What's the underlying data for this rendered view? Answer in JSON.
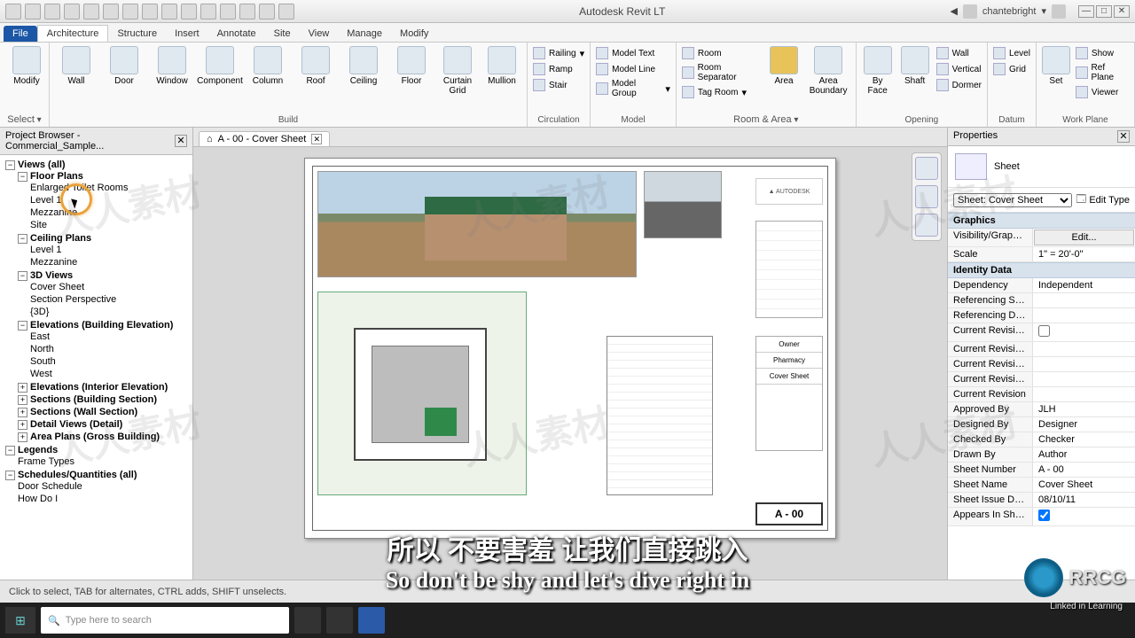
{
  "app_title": "Autodesk Revit LT",
  "user": "chantebright",
  "menu": {
    "file": "File",
    "arch": "Architecture",
    "struct": "Structure",
    "insert": "Insert",
    "annotate": "Annotate",
    "site": "Site",
    "view": "View",
    "manage": "Manage",
    "modify": "Modify"
  },
  "ribbon": {
    "select": {
      "modify": "Modify",
      "select": "Select"
    },
    "build": {
      "wall": "Wall",
      "door": "Door",
      "window": "Window",
      "component": "Component",
      "column": "Column",
      "roof": "Roof",
      "ceiling": "Ceiling",
      "floor": "Floor",
      "curtain": "Curtain\nGrid",
      "mullion": "Mullion",
      "name": "Build"
    },
    "circ": {
      "railing": "Railing",
      "ramp": "Ramp",
      "stair": "Stair",
      "name": "Circulation"
    },
    "model": {
      "text": "Model Text",
      "line": "Model Line",
      "group": "Model Group",
      "name": "Model"
    },
    "room": {
      "room": "Room",
      "sep": "Room Separator",
      "tag": "Tag Room",
      "area": "Area",
      "areab": "Area\nBoundary",
      "name": "Room & Area"
    },
    "open": {
      "face": "By\nFace",
      "shaft": "Shaft",
      "wall": "Wall",
      "vert": "Vertical",
      "dormer": "Dormer",
      "name": "Opening"
    },
    "datum": {
      "level": "Level",
      "grid": "Grid",
      "name": "Datum"
    },
    "wp": {
      "set": "Set",
      "show": "Show",
      "ref": "Ref Plane",
      "viewer": "Viewer",
      "name": "Work Plane"
    }
  },
  "pb_title": "Project Browser - Commercial_Sample...",
  "tree": {
    "root": "Views (all)",
    "floorplans": "Floor Plans",
    "fp": [
      "Enlarged Toilet Rooms",
      "Level 1",
      "Mezzanine",
      "Site"
    ],
    "ceiling": "Ceiling Plans",
    "cp": [
      "Level 1",
      "Mezzanine"
    ],
    "views3d": "3D Views",
    "v3": [
      "Cover Sheet",
      "Section Perspective",
      "{3D}"
    ],
    "elevB": "Elevations (Building Elevation)",
    "eb": [
      "East",
      "North",
      "South",
      "West"
    ],
    "elevI": "Elevations (Interior Elevation)",
    "secB": "Sections (Building Section)",
    "secW": "Sections (Wall Section)",
    "detail": "Detail Views (Detail)",
    "area": "Area Plans (Gross Building)",
    "legends": "Legends",
    "lg": [
      "Frame Types"
    ],
    "sched": "Schedules/Quantities (all)",
    "sc": [
      "Door Schedule",
      "How Do I"
    ]
  },
  "doc_tab": "A - 00 - Cover Sheet",
  "logo": "▲ AUTODESK",
  "titleblock": {
    "owner": "Owner",
    "project": "Pharmacy",
    "sheet": "Cover Sheet",
    "num": "A - 00"
  },
  "props": {
    "title": "Properties",
    "type": "Sheet",
    "selector": "Sheet: Cover Sheet",
    "edit_type": "Edit Type",
    "sec_graphics": "Graphics",
    "vis": "Visibility/Graphi...",
    "vis_v": "Edit...",
    "scale": "Scale",
    "scale_v": "1\" = 20'-0\"",
    "sec_identity": "Identity Data",
    "dep": "Dependency",
    "dep_v": "Independent",
    "refsh": "Referencing Sh...",
    "refsh_v": "",
    "refdet": "Referencing Det...",
    "refdet_v": "",
    "cr1": "Current Revisio...",
    "cr2": "Current Revisio...",
    "cr3": "Current Revisio...",
    "cr4": "Current Revisio...",
    "cr5": "Current Revision",
    "appr": "Approved By",
    "appr_v": "JLH",
    "des": "Designed By",
    "des_v": "Designer",
    "chk": "Checked By",
    "chk_v": "Checker",
    "drw": "Drawn By",
    "drw_v": "Author",
    "snum": "Sheet Number",
    "snum_v": "A - 00",
    "sname": "Sheet Name",
    "sname_v": "Cover Sheet",
    "sdate": "Sheet Issue Date",
    "sdate_v": "08/10/11",
    "appear": "Appears In Shee..."
  },
  "status": "Click to select, TAB for alternates, CTRL adds, SHIFT unselects.",
  "search_placeholder": "Type here to search",
  "subtitle_cn": "所以 不要害羞 让我们直接跳入",
  "subtitle_en": "So don't be shy and let's dive right in",
  "watermark": "人人素材",
  "rrcg": "RRCG",
  "linkedin": "Linked in Learning"
}
